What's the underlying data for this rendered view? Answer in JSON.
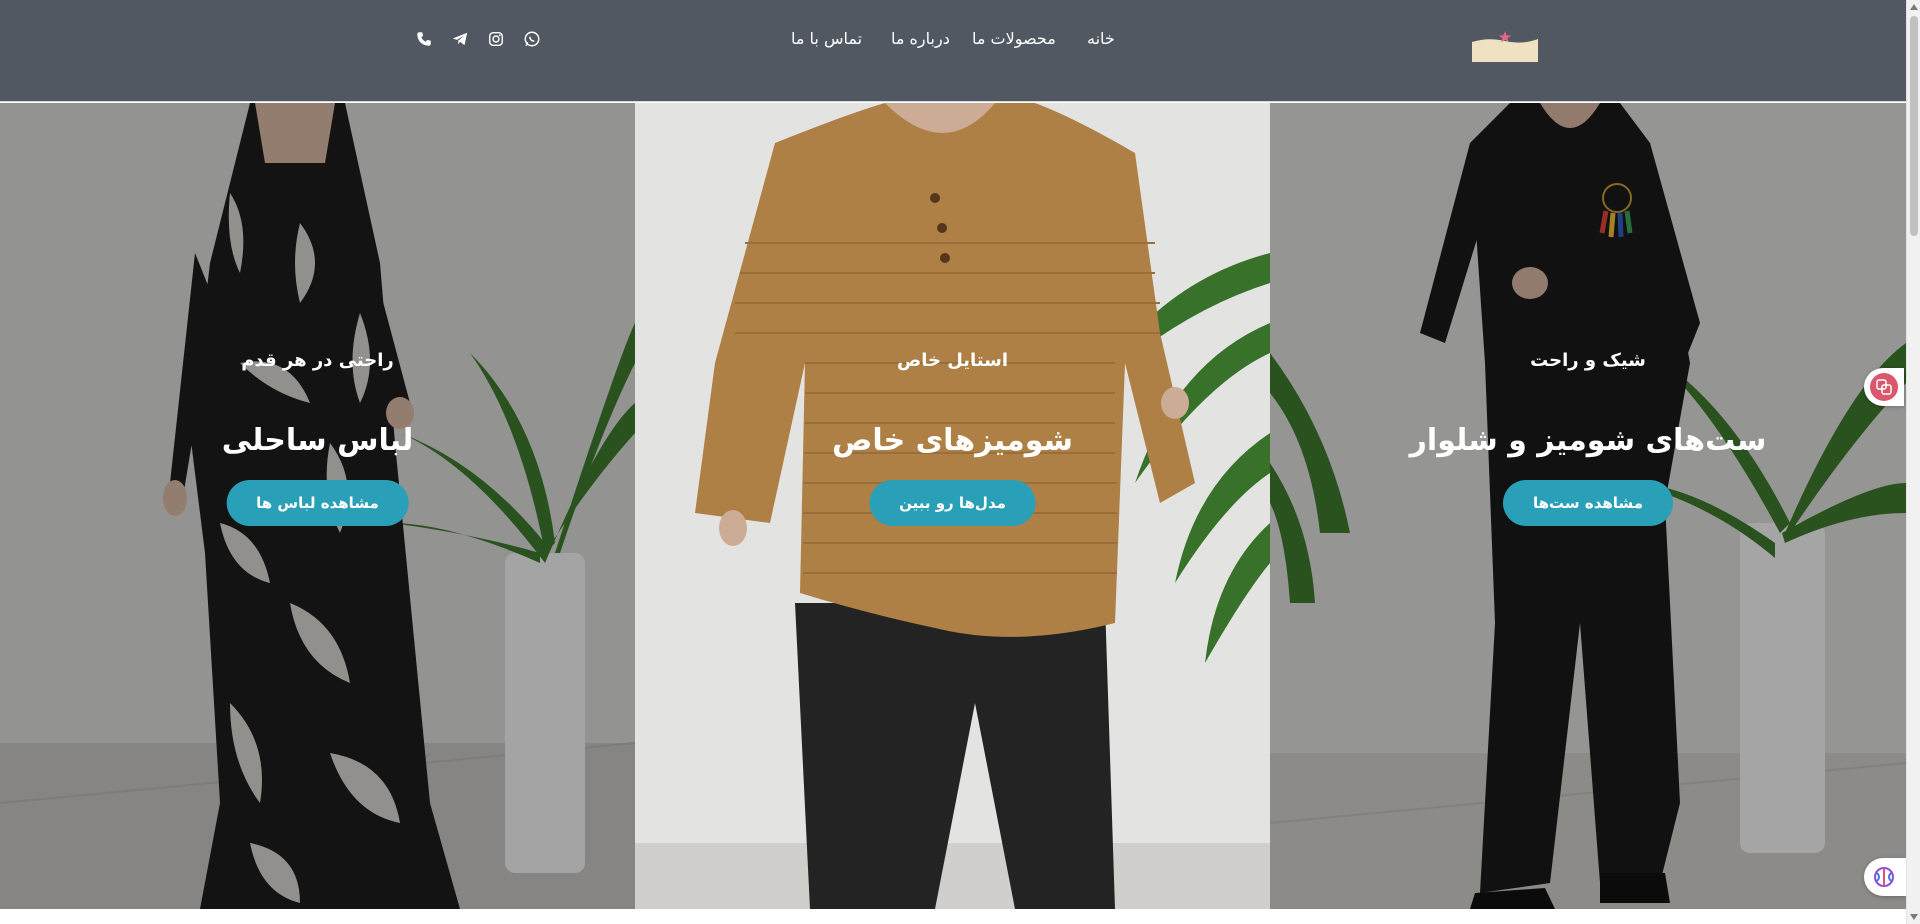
{
  "header": {
    "nav": [
      {
        "label": "خانه"
      },
      {
        "label": "محصولات ما"
      },
      {
        "label": "درباره ما"
      },
      {
        "label": "تماس با ما"
      }
    ],
    "social_icons": [
      "whatsapp-icon",
      "instagram-icon",
      "telegram-icon",
      "phone-icon"
    ]
  },
  "hero": {
    "panels": [
      {
        "tagline": "شیک و راحت",
        "heading": "ست‌های شومیز و شلوار",
        "button": "مشاهده ست‌ها"
      },
      {
        "tagline": "استایل خاص",
        "heading": "شومیزهای خاص",
        "button": "مدل‌ها رو ببین"
      },
      {
        "tagline": "راحتی در هر قدم",
        "heading": "لباس ساحلی",
        "button": "مشاهده لباس ها"
      }
    ]
  },
  "colors": {
    "header_bg": "#525862",
    "button_bg": "#2a9fb8",
    "nav_text": "#ffffff"
  }
}
